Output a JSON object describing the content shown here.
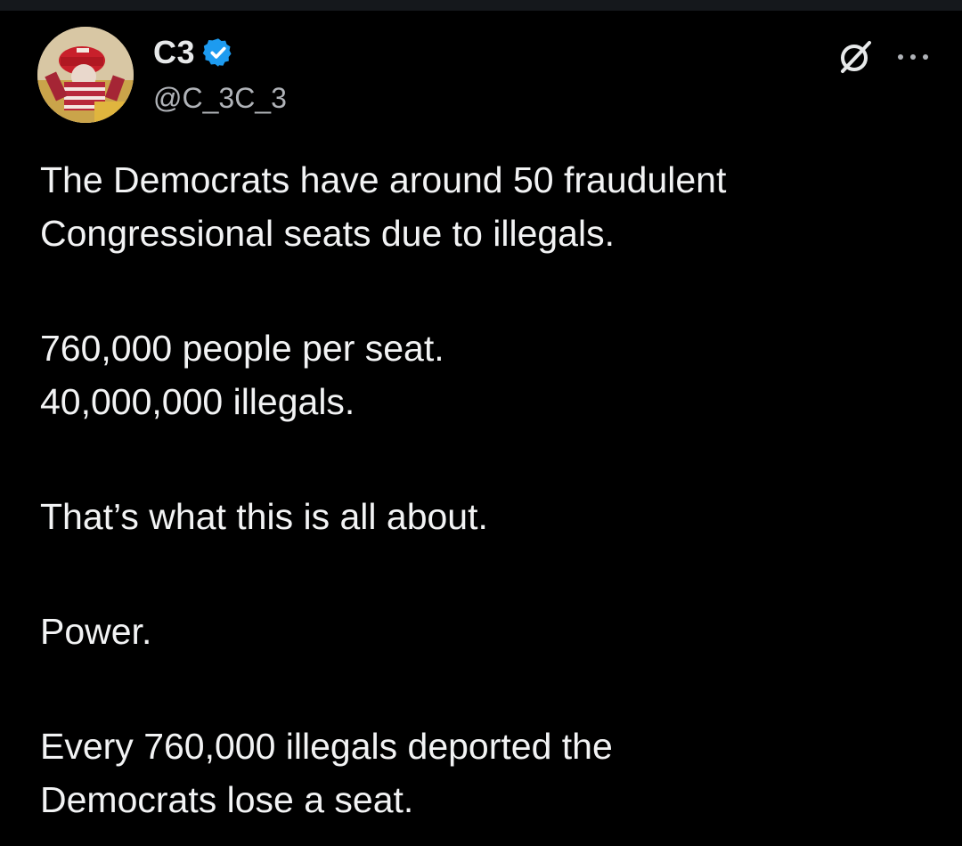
{
  "tweet": {
    "author": {
      "display_name": "C3",
      "handle": "@C_3C_3",
      "verified": true,
      "avatar_icon": "profile-avatar"
    },
    "actions": {
      "grok_icon": "grok-icon",
      "more_icon": "more-options-icon"
    },
    "body": {
      "p1_line1": "The Democrats have around 50 fraudulent",
      "p1_line2": "Congressional seats due to illegals.",
      "p2_line1": "760,000 people per seat.",
      "p2_line2": "40,000,000 illegals.",
      "p3_line1": "That’s what this is all about.",
      "p4_line1": "Power.",
      "p5_line1": "Every 760,000 illegals deported the",
      "p5_line2": "Democrats lose a seat."
    }
  },
  "colors": {
    "background": "#000000",
    "text": "#e7e9ea",
    "secondary_text": "#b0b3b8",
    "verified_blue": "#1d9bf0"
  }
}
